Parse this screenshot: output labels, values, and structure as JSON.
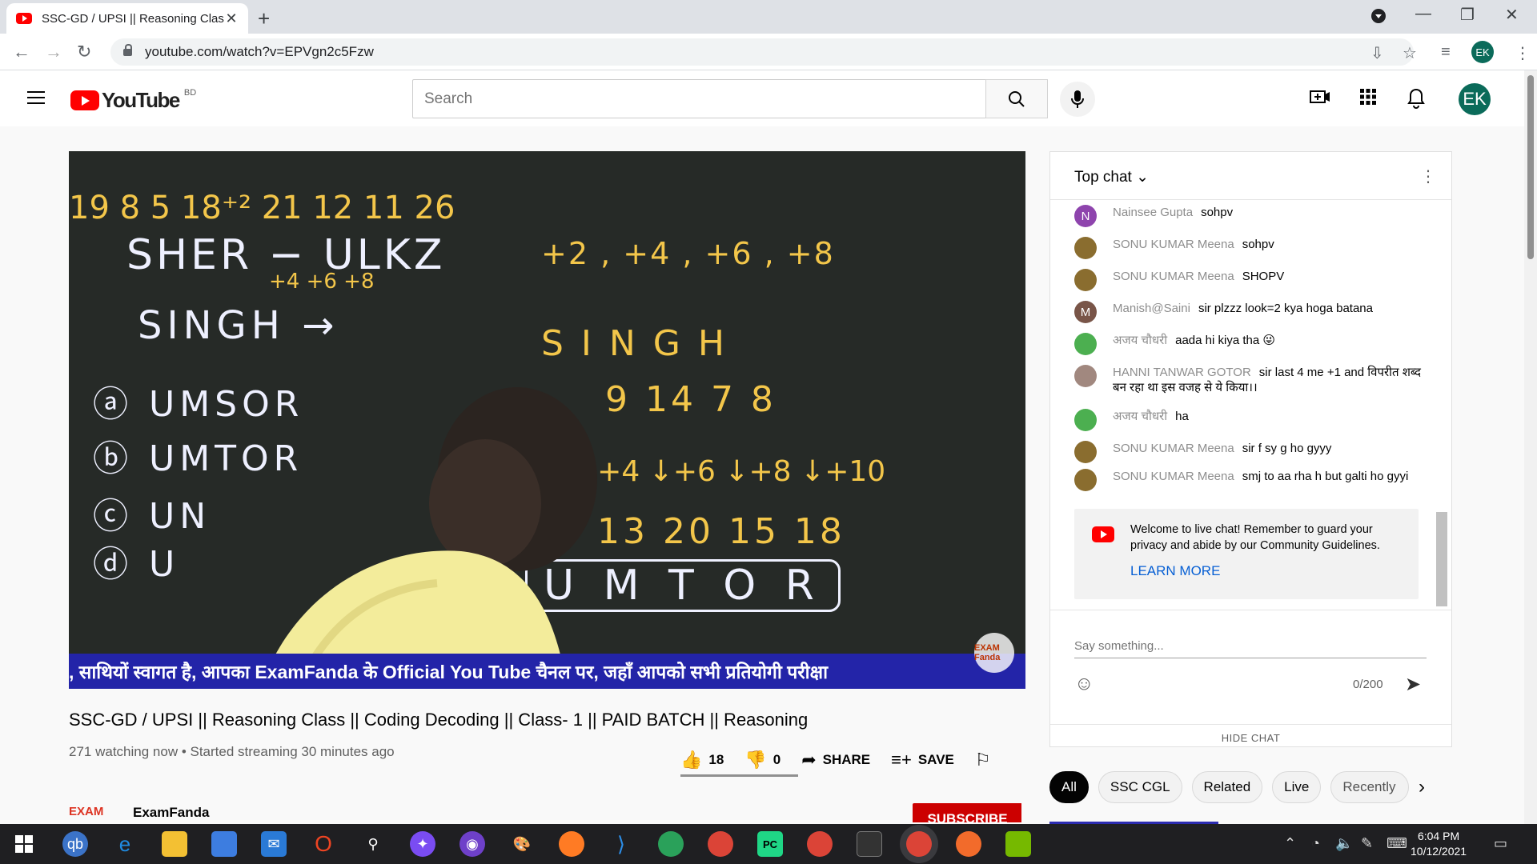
{
  "browser": {
    "tab_title": "SSC-GD / UPSI || Reasoning Clas",
    "url": "youtube.com/watch?v=EPVgn2c5Fzw",
    "profile_initials": "EK"
  },
  "youtube": {
    "logo_text": "YouTube",
    "country_code": "BD",
    "search_placeholder": "Search",
    "avatar_initials": "EK"
  },
  "video": {
    "board": {
      "line1": "19 8 5 18⁺² 21 12 11 26",
      "line2": "SHER − ULKZ",
      "line2_sub": "+4      +6  +8",
      "pattern": "+2 , +4 , +6 , +8",
      "question": "SINGH →",
      "opt_a": "UMSOR",
      "opt_b": "UMTOR",
      "opt_c": "UN",
      "opt_d": "U",
      "singh": "S  I  N  G  H",
      "nums": "9  14  7  8",
      "arrows": "↓+4  ↓+6  ↓+8  ↓+10",
      "result_nums": "13  20  15   18",
      "answer": "U  M  T  O  R"
    },
    "ticker": ", साथियों स्वागत है, आपका ExamFanda के  Official You Tube चैनल पर, जहाँ आपको सभी प्रतियोगी परीक्षा",
    "watermark": "EXAM Fanda",
    "title": "SSC-GD / UPSI || Reasoning Class || Coding Decoding || Class- 1 || PAID BATCH || Reasoning",
    "meta": "271 watching now • Started streaming 30 minutes ago",
    "likes": "18",
    "dislikes": "0",
    "share_label": "SHARE",
    "save_label": "SAVE",
    "channel_logo": "EXAM",
    "channel_name": "ExamFanda",
    "subscribe_label": "SUBSCRIBE"
  },
  "chat": {
    "mode_label": "Top chat",
    "messages": [
      {
        "author": "Nainsee Gupta",
        "text": "sohpv",
        "avatar": "N",
        "color": "#8e44ad"
      },
      {
        "author": "SONU KUMAR Meena",
        "text": "sohpv",
        "avatar": "",
        "color": "#8a6d2f"
      },
      {
        "author": "SONU KUMAR Meena",
        "text": "SHOPV",
        "avatar": "",
        "color": "#8a6d2f"
      },
      {
        "author": "Manish@Saini",
        "text": "sir plzzz look=2 kya hoga batana",
        "avatar": "M",
        "color": "#795548"
      },
      {
        "author": "अजय चौधरी",
        "text": "aada hi kiya tha 😜",
        "avatar": "",
        "color": "#4caf50"
      },
      {
        "author": "HANNI TANWAR GOTOR",
        "text": "sir last 4 me +1 and विपरीत शब्द बन रहा था इस वजह से ये किया।।",
        "avatar": "",
        "color": "#a1887f"
      },
      {
        "author": "अजय चौधरी",
        "text": "ha",
        "avatar": "",
        "color": "#4caf50"
      },
      {
        "author": "SONU KUMAR Meena",
        "text": "sir f sy g ho gyyy",
        "avatar": "",
        "color": "#8a6d2f"
      },
      {
        "author": "SONU KUMAR Meena",
        "text": "smj to aa rha h but galti ho gyyi",
        "avatar": "",
        "color": "#8a6d2f"
      }
    ],
    "welcome_text": "Welcome to live chat! Remember to guard your privacy and abide by our Community Guidelines.",
    "learn_more": "LEARN MORE",
    "input_placeholder": "Say something...",
    "char_count": "0/200",
    "hide_chat": "HIDE CHAT"
  },
  "chips": [
    "All",
    "SSC CGL",
    "Related",
    "Live",
    "Recently"
  ],
  "taskbar": {
    "time": "6:04 PM",
    "date": "10/12/2021"
  }
}
